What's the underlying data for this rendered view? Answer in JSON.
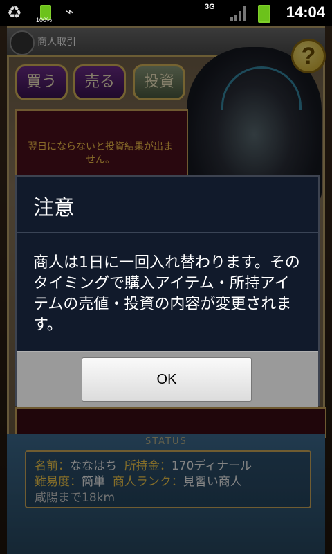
{
  "statusbar": {
    "battery_small_label": "100%",
    "network_label": "3G",
    "time": "14:04"
  },
  "game": {
    "title": "商人取引",
    "help_label": "?",
    "tabs": [
      "買う",
      "売る",
      "投資"
    ],
    "info_text": "翌日にならないと投資結果が出ません。",
    "status_heading": "STATUS",
    "status": {
      "name_label": "名前：",
      "name_value": "ななはち",
      "money_label": "所持金：",
      "money_value": "170ディナール",
      "difficulty_label": "難易度：",
      "difficulty_value": "簡単",
      "rank_label": "商人ランク：",
      "rank_value": "見習い商人",
      "distance_text": "咸陽まで18km"
    }
  },
  "dialog": {
    "title": "注意",
    "message": "商人は1日に一回入れ替わります。そのタイミングで購入アイテム・所持アイテムの売値・投資の内容が変更されます。",
    "ok_label": "OK"
  }
}
